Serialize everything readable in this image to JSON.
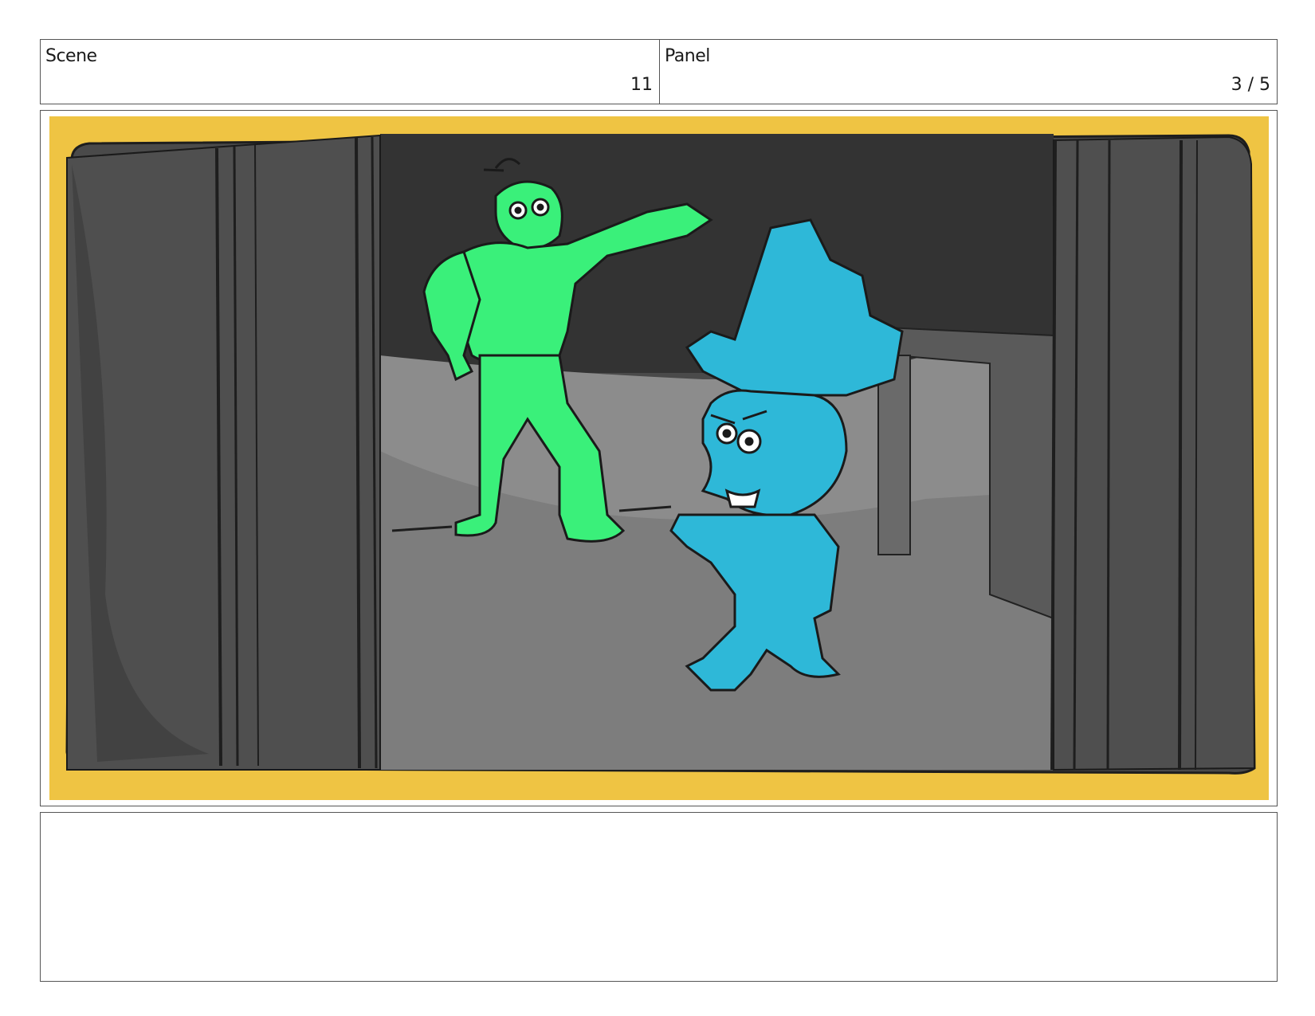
{
  "header": {
    "scene_label": "Scene",
    "scene_value": "11",
    "panel_label": "Panel",
    "panel_value": "3 / 5"
  },
  "notes": {
    "text": ""
  },
  "colors": {
    "border_yellow": "#efc443",
    "wall_dark": "#4a4a4a",
    "room_back": "#333333",
    "floor": "#8c8c8c",
    "character_green": "#3af07a",
    "character_blue": "#2eb8d8"
  }
}
